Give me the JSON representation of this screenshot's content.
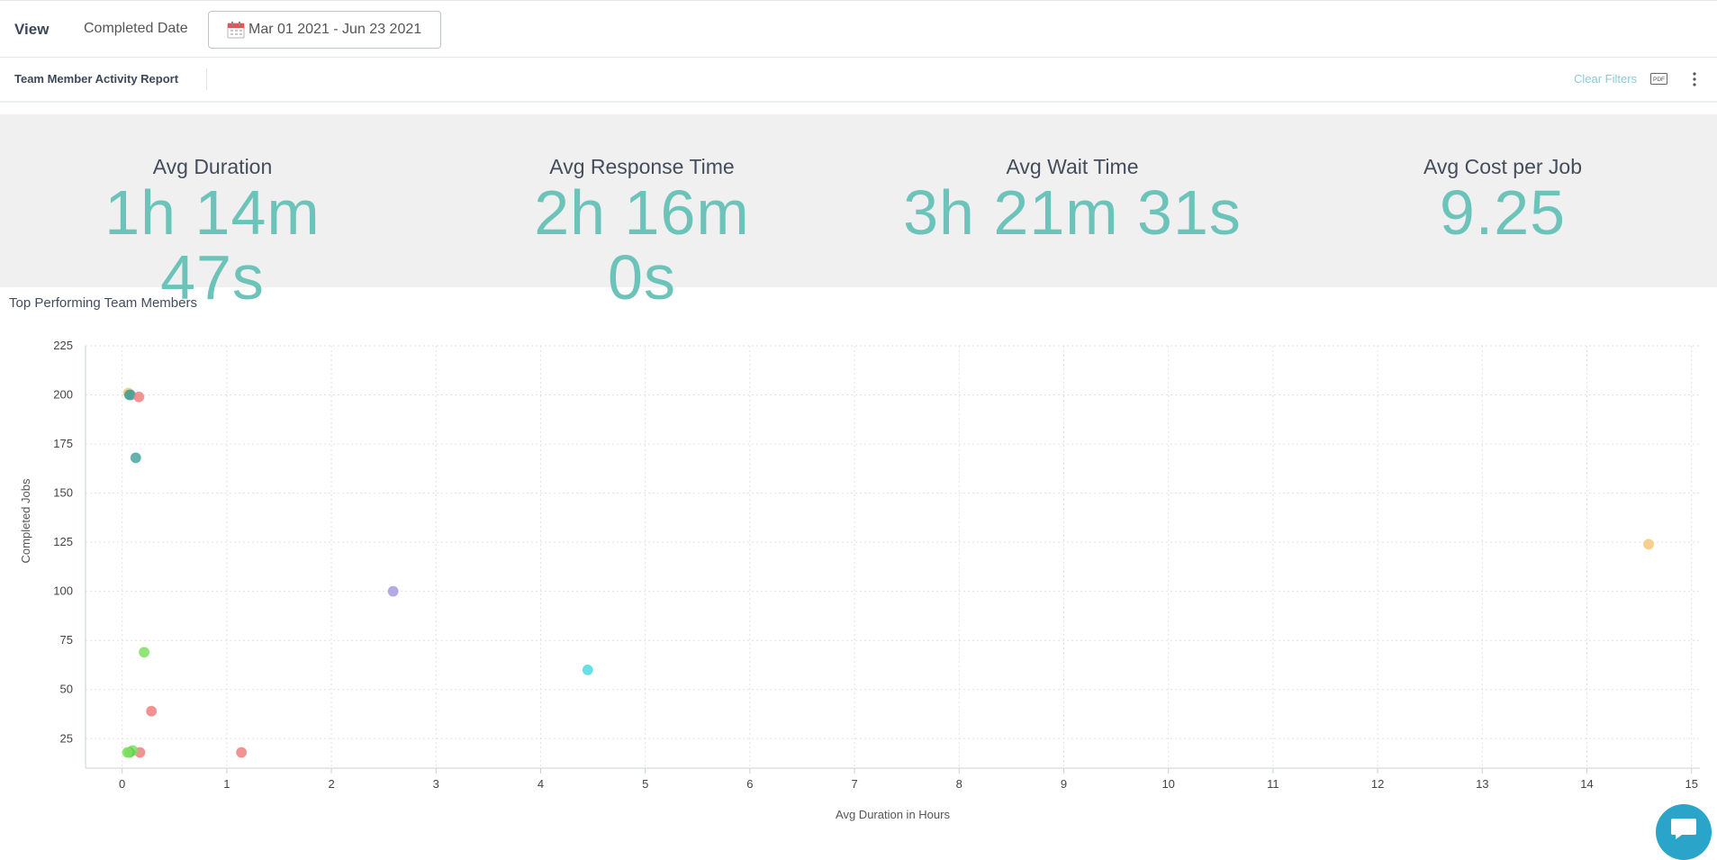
{
  "toolbar": {
    "view_label": "View",
    "filter_label": "Completed Date",
    "date_range": "Mar 01 2021 - Jun 23 2021",
    "calendar_icon": "calendar-icon"
  },
  "report": {
    "title": "Team Member Activity Report",
    "clear_filters": "Clear Filters",
    "pdf_icon": "pdf-icon",
    "more_icon": "more-vertical-icon"
  },
  "kpis": [
    {
      "label": "Avg Duration",
      "value": "1h 14m 47s"
    },
    {
      "label": "Avg Response Time",
      "value": "2h 16m 0s"
    },
    {
      "label": "Avg Wait Time",
      "value": "3h 21m 31s"
    },
    {
      "label": "Avg Cost per Job",
      "value": "9.25"
    }
  ],
  "colors": {
    "accent": "#6cc3ba",
    "link": "#8ec9d4",
    "kpi_band": "#f0f0f0"
  },
  "chart_title": "Top Performing Team Members",
  "chart_data": {
    "type": "scatter",
    "xlabel": "Avg Duration in Hours",
    "ylabel": "Completed Jobs",
    "xlim": [
      -0.35,
      15.08
    ],
    "ylim": [
      10,
      225
    ],
    "xticks": [
      0,
      1,
      2,
      3,
      4,
      5,
      6,
      7,
      8,
      9,
      10,
      11,
      12,
      13,
      14,
      15
    ],
    "yticks": [
      25,
      50,
      75,
      100,
      125,
      150,
      175,
      200,
      225
    ],
    "grid": true,
    "points": [
      {
        "x": 0.06,
        "y": 201,
        "color": "#f5c97a"
      },
      {
        "x": 0.08,
        "y": 200,
        "color": "#5c8fd6"
      },
      {
        "x": 0.07,
        "y": 200,
        "color": "#4aa58f"
      },
      {
        "x": 0.16,
        "y": 199,
        "color": "#f08080"
      },
      {
        "x": 0.13,
        "y": 168,
        "color": "#4aa5a0"
      },
      {
        "x": 2.59,
        "y": 100,
        "color": "#a99be0"
      },
      {
        "x": 14.59,
        "y": 124,
        "color": "#f8c77a"
      },
      {
        "x": 0.21,
        "y": 69,
        "color": "#7ee060"
      },
      {
        "x": 4.45,
        "y": 60,
        "color": "#4fd8e0"
      },
      {
        "x": 0.28,
        "y": 39,
        "color": "#f08080"
      },
      {
        "x": 1.14,
        "y": 18,
        "color": "#f08080"
      },
      {
        "x": 0.17,
        "y": 18,
        "color": "#f08080"
      },
      {
        "x": 0.1,
        "y": 19,
        "color": "#7ee060"
      },
      {
        "x": 0.07,
        "y": 18,
        "color": "#56cc4a"
      },
      {
        "x": 0.05,
        "y": 18,
        "color": "#7ee060"
      }
    ]
  },
  "chat": {
    "icon": "chat-icon"
  }
}
